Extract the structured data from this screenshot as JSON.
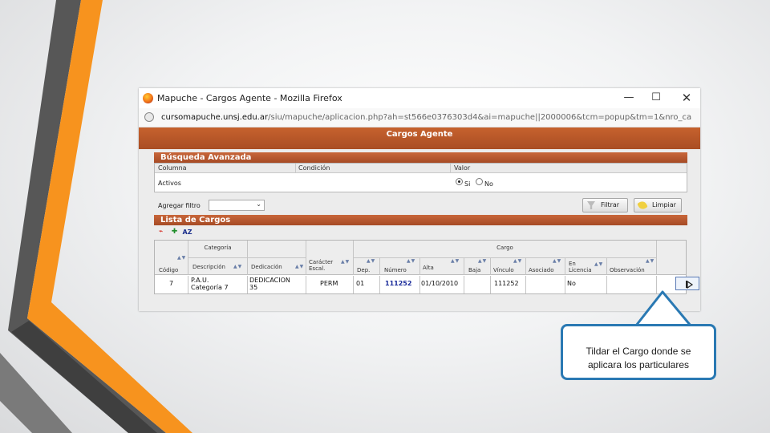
{
  "theme": {
    "accent": "#f7931e",
    "frame_gray": "#555555",
    "app_header": "#b5552a",
    "callout_border": "#2a79b3"
  },
  "window": {
    "title": "Mapuche - Cargos Agente - Mozilla Firefox",
    "url_domain": "cursomapuche.unsj.edu.ar",
    "url_rest": "/siu/mapuche/aplicacion.php?ah=st566e0376303d4&ai=mapuche||2000006&tcm=popup&tm=1&nro_ca",
    "minimize": "—",
    "maximize": "☐",
    "close": "✕"
  },
  "app": {
    "header": "Cargos Agente",
    "busqueda": {
      "title": "Búsqueda Avanzada",
      "col_columna": "Columna",
      "col_condicion": "Condición",
      "col_valor": "Valor",
      "row_label": "Activos",
      "radio_si": "Si",
      "radio_no": "No",
      "selected": "Si"
    },
    "agregar_filtro": {
      "label": "Agregar filtro",
      "value": ""
    },
    "btn_filtrar": "Filtrar",
    "btn_limpiar": "Limpiar",
    "lista": {
      "title": "Lista de Cargos",
      "tool_pdf": "pdf-icon",
      "tool_excel": "excel-icon",
      "tool_sort": "AZ",
      "group_categoria": "Categoría",
      "group_cargo": "Cargo",
      "headers": {
        "codigo": "Código",
        "descripcion": "Descripción",
        "dedicacion": "Dedicación",
        "caracter1": "Carácter",
        "caracter2": "Escal.",
        "dep": "Dep.",
        "numero": "Número",
        "alta": "Alta",
        "baja": "Baja",
        "vinculo": "Vínculo",
        "asociado": "Asociado",
        "licencia1": "En",
        "licencia2": "Licencia",
        "observacion": "Observación"
      },
      "rows": [
        {
          "codigo": "7",
          "descripcion1": "P.A.U.",
          "descripcion2": "Categoría 7",
          "dedicacion1": "DEDICACION",
          "dedicacion2": "35",
          "caracter": "PERM",
          "dep": "01",
          "numero": "111252",
          "alta": "01/10/2010",
          "baja": "",
          "vinculo": "111252",
          "asociado": "",
          "licencia": "No",
          "observacion": ""
        }
      ]
    }
  },
  "callout": {
    "line1": "Tildar el Cargo donde se",
    "line2": "aplicara los particulares"
  }
}
